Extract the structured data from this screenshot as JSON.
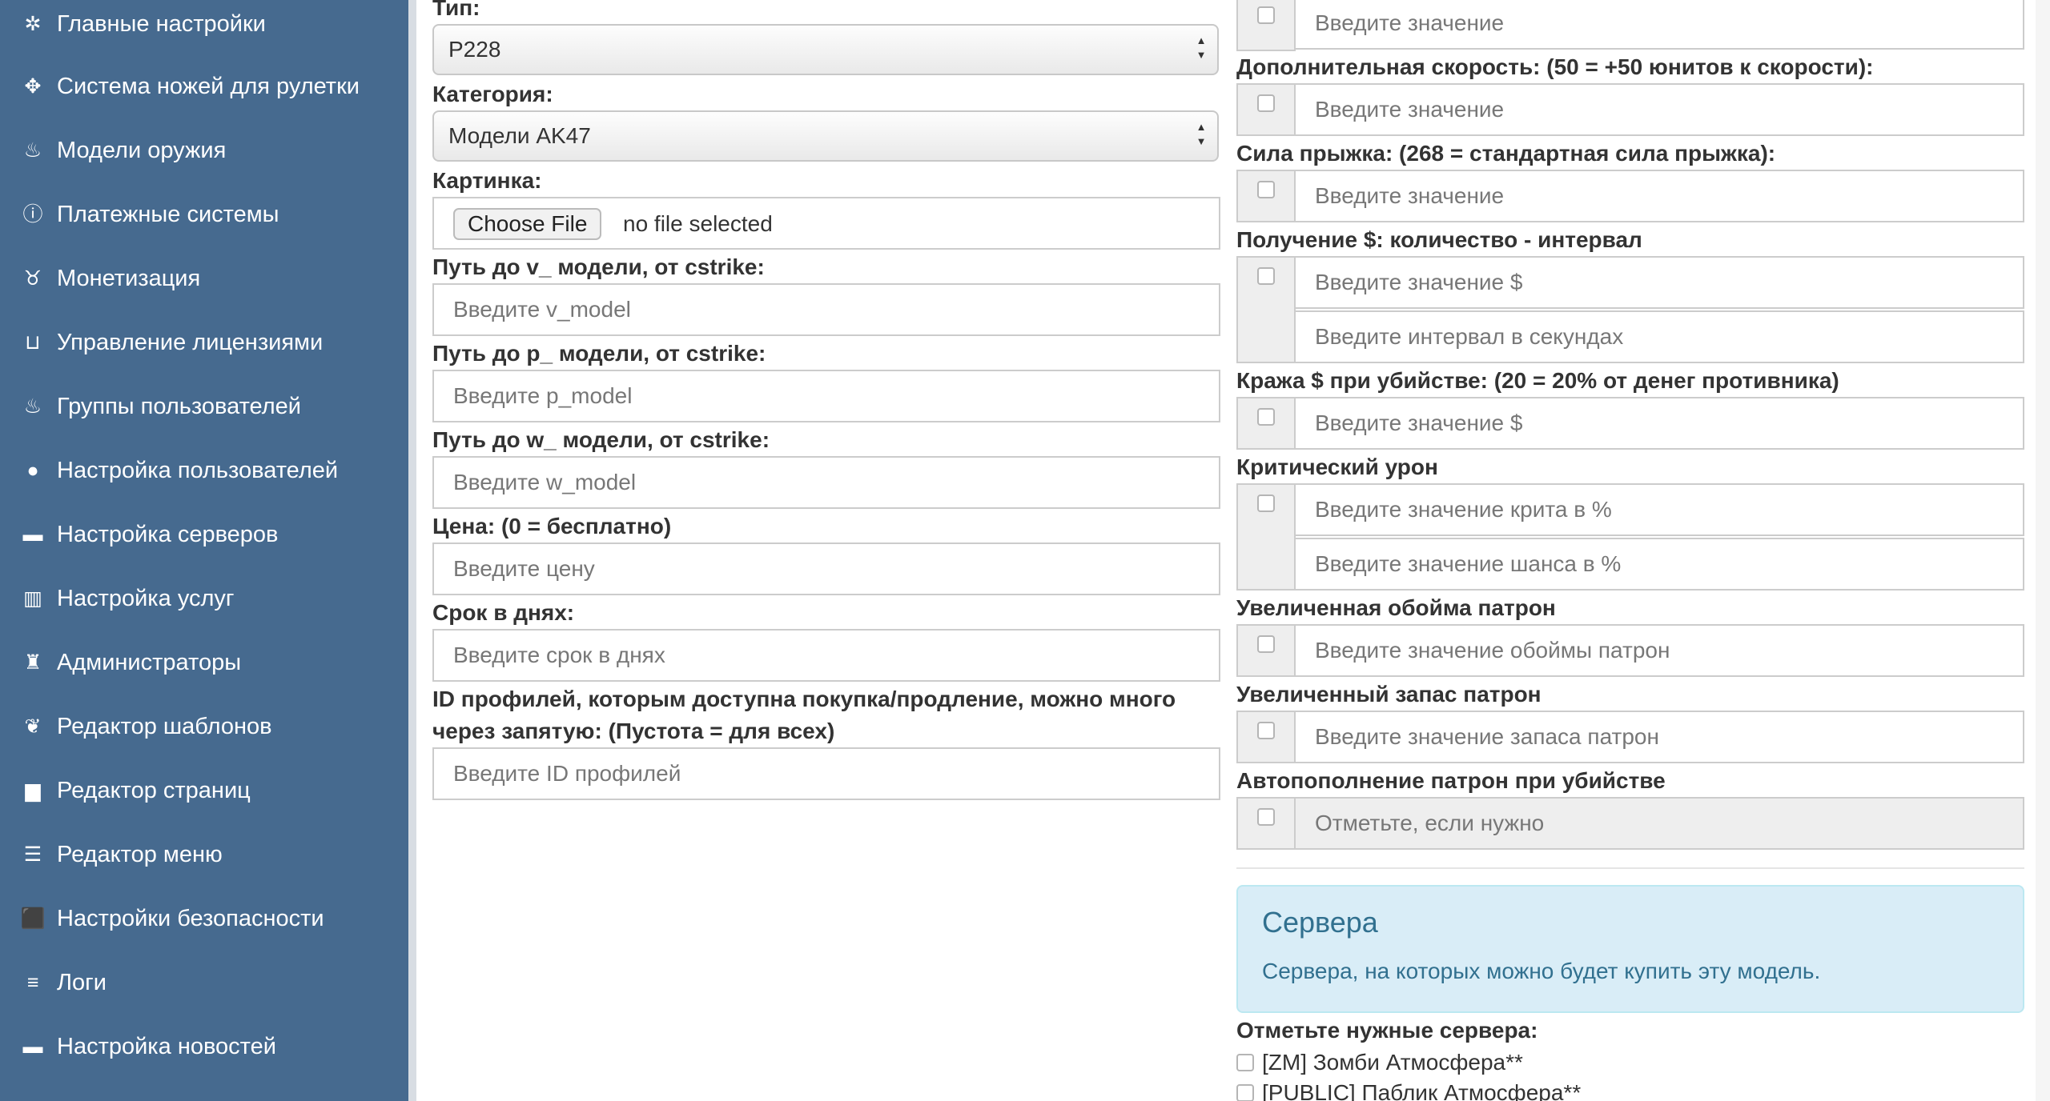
{
  "sidebar": {
    "items": [
      {
        "label": "Главные настройки",
        "icon": "gear-icon",
        "glyph": "✲"
      },
      {
        "label": "Система ножей для рулетки",
        "icon": "crosshair-icon",
        "glyph": "✥"
      },
      {
        "label": "Модели оружия",
        "icon": "fire-icon",
        "glyph": "♨"
      },
      {
        "label": "Платежные системы",
        "icon": "info-icon",
        "glyph": "ⓘ"
      },
      {
        "label": "Монетизация",
        "icon": "piggy-bank-icon",
        "glyph": "♉"
      },
      {
        "label": "Управление лицензиями",
        "icon": "inbox-icon",
        "glyph": "⊔"
      },
      {
        "label": "Группы пользователей",
        "icon": "fire-icon",
        "glyph": "♨"
      },
      {
        "label": "Настройка пользователей",
        "icon": "user-icon",
        "glyph": "●"
      },
      {
        "label": "Настройка серверов",
        "icon": "hdd-icon",
        "glyph": "▬"
      },
      {
        "label": "Настройка услуг",
        "icon": "barcode-icon",
        "glyph": "▥"
      },
      {
        "label": "Администраторы",
        "icon": "tower-icon",
        "glyph": "♜"
      },
      {
        "label": "Редактор шаблонов",
        "icon": "leaf-icon",
        "glyph": "❦"
      },
      {
        "label": "Редактор страниц",
        "icon": "file-icon",
        "glyph": "▆"
      },
      {
        "label": "Редактор меню",
        "icon": "list-icon",
        "glyph": "☰"
      },
      {
        "label": "Настройки безопасности",
        "icon": "lock-icon",
        "glyph": "⬛"
      },
      {
        "label": "Логи",
        "icon": "menu-lines-icon",
        "glyph": "≡"
      },
      {
        "label": "Настройка новостей",
        "icon": "briefcase-icon",
        "glyph": "▬"
      }
    ]
  },
  "left_form": {
    "type_label": "Тип:",
    "type_value": "P228",
    "category_label": "Категория:",
    "category_value": "Модели AK47",
    "image_label": "Картинка:",
    "file_button": "Choose File",
    "file_status": "no file selected",
    "v_model_label": "Путь до v_ модели, от cstrike:",
    "v_model_placeholder": "Введите v_model",
    "p_model_label": "Путь до p_ модели, от cstrike:",
    "p_model_placeholder": "Введите p_model",
    "w_model_label": "Путь до w_ модели, от cstrike:",
    "w_model_placeholder": "Введите w_model",
    "price_label": "Цена: (0 = бесплатно)",
    "price_placeholder": "Введите цену",
    "term_label": "Срок в днях:",
    "term_placeholder": "Введите срок в днях",
    "profiles_label": "ID профилей, которым доступна покупка/продление, можно много через запятую: (Пустота = для всех)",
    "profiles_placeholder": "Введите ID профилей"
  },
  "right_form": {
    "top_placeholder": "Введите значение",
    "speed_label": "Дополнительная скорость: (50 = +50 юнитов к скорости):",
    "speed_placeholder": "Введите значение",
    "jump_label": "Сила прыжка: (268 = стандартная сила прыжка):",
    "jump_placeholder": "Введите значение",
    "money_label": "Получение $: количество - интервал",
    "money_amount_placeholder": "Введите значение $",
    "money_interval_placeholder": "Введите интервал в секундах",
    "steal_label": "Кража $ при убийстве: (20 = 20% от денег противника)",
    "steal_placeholder": "Введите значение $",
    "crit_label": "Критический урон",
    "crit_value_placeholder": "Введите значение крита в %",
    "crit_chance_placeholder": "Введите значение шанса в %",
    "clip_label": "Увеличенная обойма патрон",
    "clip_placeholder": "Введите значение обоймы патрон",
    "ammo_label": "Увеличенный запас патрон",
    "ammo_placeholder": "Введите значение запаса патрон",
    "refill_label": "Автопополнение патрон при убийстве",
    "refill_text": "Отметьте, если нужно"
  },
  "servers": {
    "title": "Сервера",
    "description": "Сервера, на которых можно будет купить эту модель.",
    "select_label": "Отметьте нужные сервера:",
    "items": [
      "[ZM] Зомби Атмосфера**",
      "[PUBLIC] Паблик Атмосфера**"
    ]
  },
  "colors": {
    "sidebar_bg": "#466a8f",
    "alert_bg": "#d9edf7",
    "alert_text": "#31708f"
  }
}
